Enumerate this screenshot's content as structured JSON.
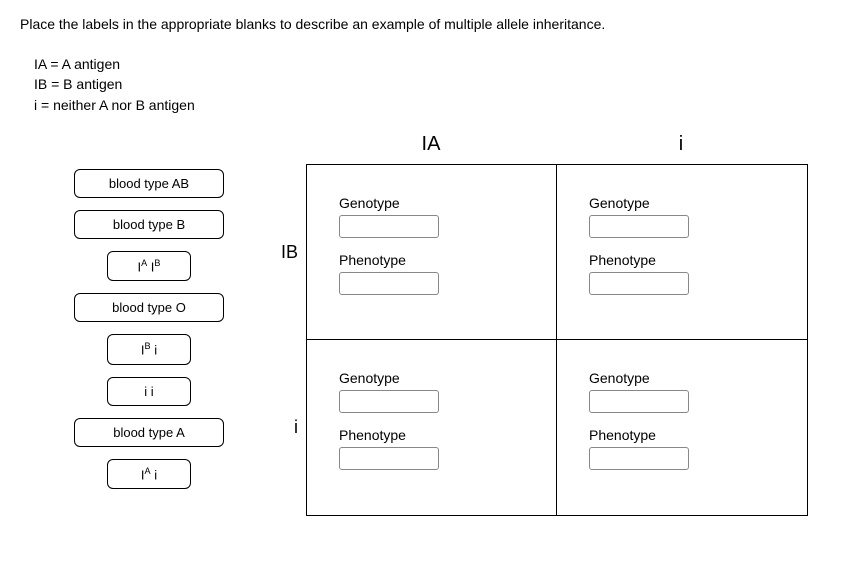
{
  "instruction": "Place the labels in the appropriate blanks to describe an example of multiple allele inheritance.",
  "legend": {
    "line1": "IA = A antigen",
    "line2": "IB = B antigen",
    "line3": " i = neither A nor B antigen"
  },
  "drag_labels": {
    "ab": "blood type AB",
    "b": "blood type B",
    "iaib": "IA IB",
    "o": "blood type O",
    "ibi": "IB i",
    "ii": "i i",
    "a": "blood type A",
    "iai": "IA i"
  },
  "punnett": {
    "col1": "IA",
    "col2": "i",
    "row1": "IB",
    "row2": "i",
    "field_genotype": "Genotype",
    "field_phenotype": "Phenotype"
  }
}
